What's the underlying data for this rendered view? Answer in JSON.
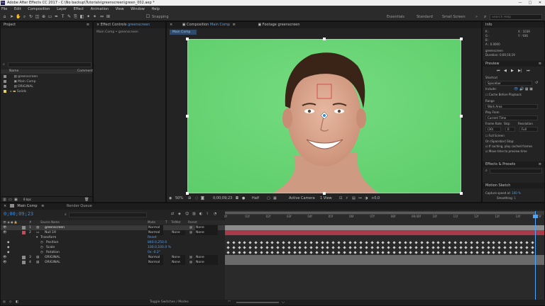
{
  "window": {
    "title": "Adobe After Effects CC 2017 - C:\\No backup\\Tutorials\\greenscreen\\green_002.aep *",
    "controls": [
      "—",
      "□",
      "✕"
    ]
  },
  "menu": [
    "File",
    "Edit",
    "Composition",
    "Layer",
    "Effect",
    "Animation",
    "View",
    "Window",
    "Help"
  ],
  "toolbar": {
    "snapping": "Snapping",
    "workspaces": [
      "Essentials",
      "Standard",
      "Small Screen"
    ],
    "search_placeholder": "Search Help"
  },
  "project": {
    "title": "Project",
    "search_placeholder": "",
    "columns": [
      "Name",
      "Comment"
    ],
    "items": [
      {
        "name": "greenscreen",
        "color": "#8c8c8c"
      },
      {
        "name": "Main Comp",
        "color": "#8c8c8c"
      },
      {
        "name": "ORIGINAL",
        "color": "#8c8c8c"
      },
      {
        "name": "Solids",
        "color": "#e6d25a"
      }
    ],
    "footer": "8 bpc"
  },
  "effect_controls": {
    "tab_label": "Effect Controls",
    "tab_target": "greenscreen",
    "breadcrumb": "Main Comp • greenscreen"
  },
  "composition": {
    "tab_label": "Composition",
    "tab_target": "Main Comp",
    "footage_tab": "Footage greenscreen",
    "comp_chip": "Main Comp",
    "footer": {
      "zoom": "50%",
      "timecode": "0;00;09;23",
      "resolution": "Half",
      "camera": "Active Camera",
      "view": "1 View",
      "offset": "+0,0"
    }
  },
  "info": {
    "title": "Info",
    "r": "R :",
    "g": "G :",
    "b": "B :",
    "a": "A : 0.0000",
    "x": "X : 1039",
    "y": "Y : 936",
    "layer_name": "greenscreen",
    "duration": "Duration: 0;00;16;19"
  },
  "preview": {
    "title": "Preview",
    "shortcut_label": "Shortcut",
    "shortcut_value": "Spacebar",
    "include_label": "Include:",
    "cache_label": "Cache Before Playback",
    "range_label": "Range",
    "range_value": "Work Area",
    "play_from_label": "Play From",
    "play_from_value": "Current Time",
    "frame_rate_label": "Frame Rate",
    "skip_label": "Skip",
    "resolution_label": "Resolution",
    "frame_rate_value": "(30)",
    "skip_value": "0",
    "resolution_value": "Full",
    "full_screen_label": "Full Screen",
    "on_stop_label": "On (Spacebar) Stop:",
    "if_caching": "If caching, play cached frames",
    "move_time": "Move time to preview time"
  },
  "effects_presets": {
    "title": "Effects & Presets",
    "search_placeholder": ""
  },
  "motion_sketch": {
    "title": "Motion Sketch",
    "capture_label": "Capture speed at:",
    "capture_value": "100 %",
    "smoothing_label": "Smoothing:",
    "smoothing_value": "1"
  },
  "timeline": {
    "tab_main": "Main Comp",
    "tab_render": "Render Queue",
    "timecode": "0;00;09;23",
    "search_placeholder": "",
    "columns": [
      "Source Name",
      "Mode",
      "T",
      "TrkMat",
      "Parent"
    ],
    "layers": [
      {
        "num": "1",
        "name": "greenscreen",
        "mode": "Normal",
        "trkmat": "",
        "parent": "None",
        "color": "#8c8c8c",
        "bar": "#8c8c8c",
        "selected": true
      },
      {
        "num": "2",
        "name": "Null 19",
        "mode": "Normal",
        "trkmat": "None",
        "parent": "None",
        "color": "#c84a5a",
        "bar": "#a83a4a",
        "selected": false
      },
      {
        "num": "3",
        "name": "ORIGINAL",
        "mode": "Normal",
        "trkmat": "None",
        "parent": "None",
        "color": "#8c8c8c",
        "bar": "#6a6a6a",
        "selected": false
      },
      {
        "num": "4",
        "name": "ORIGINAL",
        "mode": "Normal",
        "trkmat": "None",
        "parent": "None",
        "color": "#8c8c8c",
        "bar": "#6a6a6a",
        "selected": false
      }
    ],
    "transform": {
      "label": "Transform",
      "reset": "Reset",
      "position_label": "Position",
      "position_value": "840.0,250.0",
      "scale_label": "Scale",
      "scale_value": "100.0,100.0 %",
      "rotation_label": "Rotation",
      "rotation_value": "0x -0.2°"
    },
    "ruler": [
      "0f",
      "01f",
      "02f",
      "03f",
      "04f",
      "05f",
      "06f",
      "07f",
      "08f",
      "09;00f",
      "10f",
      "11f",
      "12f",
      "13f",
      "14f",
      "15f"
    ],
    "footer": "Toggle Switches / Modes"
  },
  "colors": {
    "green_screen": "#6fd87a",
    "accent_blue": "#2d8ceb",
    "playhead": "#4aa3ff"
  }
}
